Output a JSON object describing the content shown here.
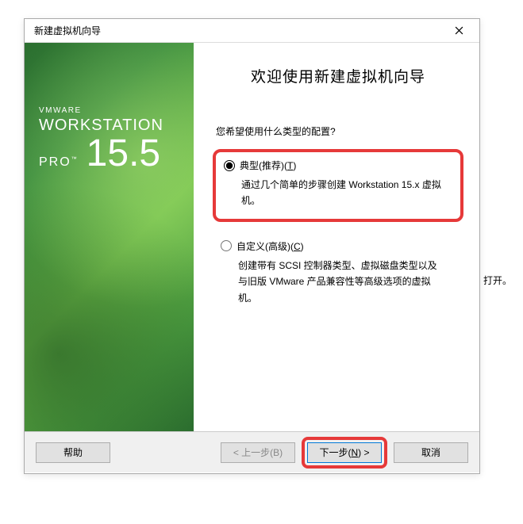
{
  "titlebar": {
    "title": "新建虚拟机向导"
  },
  "sidebar": {
    "vmware": "VMWARE",
    "workstation": "WORKSTATION",
    "pro": "PRO",
    "tm": "™",
    "version": "15.5"
  },
  "content": {
    "heading": "欢迎使用新建虚拟机向导",
    "question": "您希望使用什么类型的配置?",
    "option1": {
      "label_pre": "典型(推荐)(",
      "accel": "T",
      "label_post": ")",
      "desc": "通过几个简单的步骤创建 Workstation 15.x 虚拟机。"
    },
    "option2": {
      "label_pre": "自定义(高级)(",
      "accel": "C",
      "label_post": ")",
      "desc": "创建带有 SCSI 控制器类型、虚拟磁盘类型以及与旧版 VMware 产品兼容性等高级选项的虚拟机。"
    }
  },
  "footer": {
    "help": "帮助",
    "back": "< 上一步(B)",
    "next_pre": "下一步(",
    "next_accel": "N",
    "next_post": ") >",
    "cancel": "取消"
  },
  "external": {
    "fragment": "打开。"
  }
}
